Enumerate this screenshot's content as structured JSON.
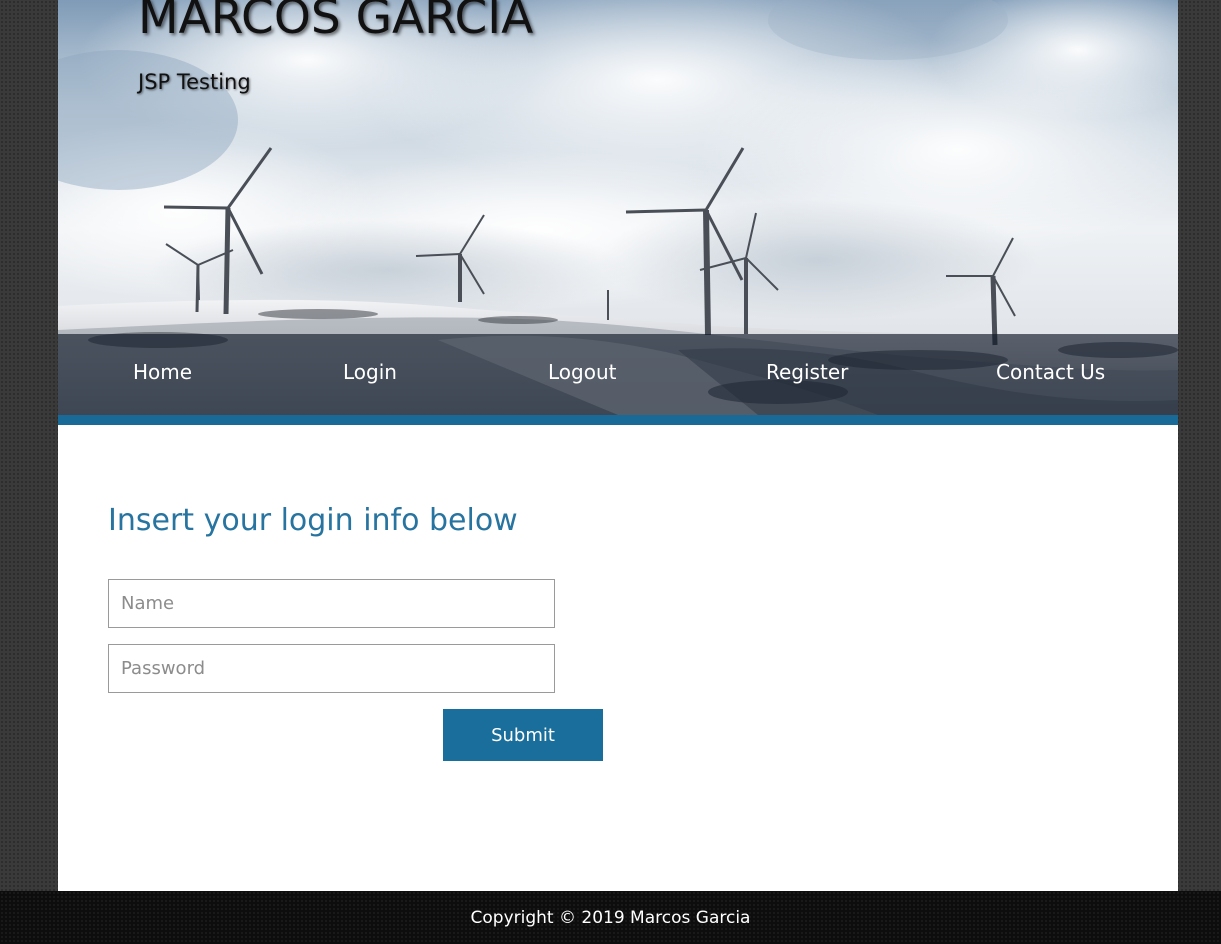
{
  "header": {
    "title": "MARCOS GARCIA",
    "subtitle": "JSP Testing"
  },
  "nav": {
    "items": [
      {
        "label": "Home"
      },
      {
        "label": "Login"
      },
      {
        "label": "Logout"
      },
      {
        "label": "Register"
      },
      {
        "label": "Contact Us"
      }
    ]
  },
  "login_form": {
    "heading": "Insert your login info below",
    "name_placeholder": "Name",
    "name_value": "",
    "password_placeholder": "Password",
    "password_value": "",
    "submit_label": "Submit"
  },
  "footer": {
    "copyright": "Copyright © 2019 Marcos Garcia"
  },
  "colors": {
    "accent": "#1a6a98",
    "heading": "#2874a0",
    "button": "#1a6e9c",
    "footer_bg": "#0d0d0d"
  },
  "icons": {
    "hero": "wind-turbines-landscape-image"
  }
}
